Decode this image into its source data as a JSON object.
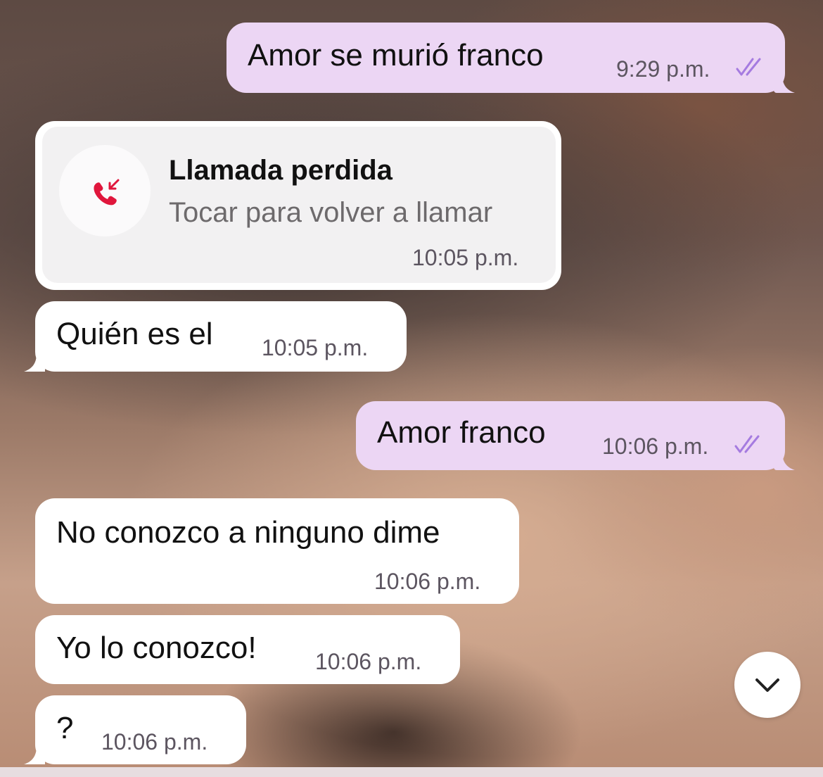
{
  "chat": {
    "messages": [
      {
        "direction": "outgoing",
        "text": "Amor se murió franco",
        "time": "9:29 p.m.",
        "status": "read"
      },
      {
        "direction": "incoming",
        "type": "call",
        "title": "Llamada perdida",
        "subtitle": "Tocar para volver a llamar",
        "time": "10:05 p.m."
      },
      {
        "direction": "incoming",
        "text": "Quién es el",
        "time": "10:05 p.m."
      },
      {
        "direction": "outgoing",
        "text": "Amor franco",
        "time": "10:06 p.m.",
        "status": "read"
      },
      {
        "direction": "incoming",
        "text": "No conozco a ninguno dime",
        "time": "10:06 p.m."
      },
      {
        "direction": "incoming",
        "text": "Yo lo conozco!",
        "time": "10:06 p.m."
      },
      {
        "direction": "incoming",
        "text": "?",
        "time": "10:06 p.m."
      }
    ]
  },
  "icons": {
    "missed_call": "missed-call-icon",
    "read_receipt": "double-check-icon",
    "scroll_down": "chevron-down-icon"
  },
  "colors": {
    "outgoing_bubble": "#ecd6f4",
    "incoming_bubble": "#ffffff",
    "call_card": "#f2f1f2",
    "missed_call_red": "#e0163c",
    "read_tick": "#a57be0"
  }
}
